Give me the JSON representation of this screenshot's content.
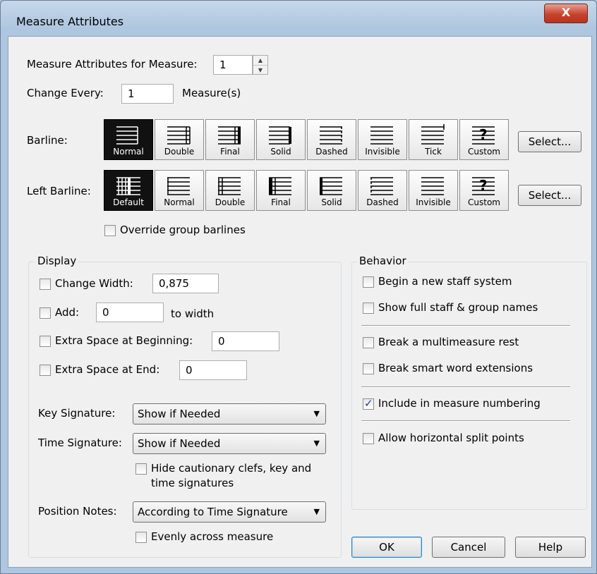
{
  "window": {
    "title": "Measure Attributes",
    "close_label": "X"
  },
  "measure": {
    "label": "Measure Attributes for Measure:",
    "value": "1"
  },
  "change_every": {
    "label": "Change Every:",
    "value": "1",
    "suffix": "Measure(s)"
  },
  "barline": {
    "label": "Barline:",
    "options": [
      "Normal",
      "Double",
      "Final",
      "Solid",
      "Dashed",
      "Invisible",
      "Tick",
      "Custom"
    ],
    "selected": "Normal",
    "select_label": "Select..."
  },
  "left_barline": {
    "label": "Left Barline:",
    "options": [
      "Default",
      "Normal",
      "Double",
      "Final",
      "Solid",
      "Dashed",
      "Invisible",
      "Custom"
    ],
    "selected": "Default",
    "select_label": "Select..."
  },
  "override_group": {
    "label": "Override group barlines",
    "checked": false
  },
  "display": {
    "title": "Display",
    "change_width": {
      "label": "Change Width:",
      "value": "0,875",
      "checked": false
    },
    "add": {
      "label": "Add:",
      "value": "0",
      "suffix": "to width",
      "checked": false
    },
    "extra_begin": {
      "label": "Extra Space at Beginning:",
      "value": "0",
      "checked": false
    },
    "extra_end": {
      "label": "Extra Space at End:",
      "value": "0",
      "checked": false
    },
    "key_signature": {
      "label": "Key Signature:",
      "value": "Show if Needed"
    },
    "time_signature": {
      "label": "Time Signature:",
      "value": "Show if Needed"
    },
    "hide_cautionary": {
      "label_line1": "Hide cautionary clefs, key and",
      "label_line2": "time signatures",
      "checked": false
    },
    "position_notes": {
      "label": "Position Notes:",
      "value": "According to Time Signature"
    },
    "evenly": {
      "label": "Evenly across measure",
      "checked": false
    }
  },
  "behavior": {
    "title": "Behavior",
    "items": [
      {
        "label": "Begin a new staff system",
        "checked": false
      },
      {
        "label": "Show full staff & group names",
        "checked": false
      },
      {
        "label": "Break a multimeasure rest",
        "checked": false
      },
      {
        "label": "Break smart word extensions",
        "checked": false
      },
      {
        "label": "Include in measure numbering",
        "checked": true
      },
      {
        "label": "Allow horizontal split points",
        "checked": false
      }
    ]
  },
  "buttons": {
    "ok": "OK",
    "cancel": "Cancel",
    "help": "Help"
  }
}
